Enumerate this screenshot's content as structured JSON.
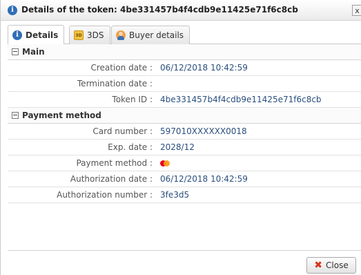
{
  "dialog": {
    "title": "Details of the token: 4be331457b4f4cdb9e11425e71f6c8cb",
    "close_glyph": "x"
  },
  "tabs": [
    {
      "label": "Details",
      "icon": "info-icon",
      "active": true
    },
    {
      "label": "3DS",
      "icon": "3ds-icon",
      "active": false
    },
    {
      "label": "Buyer details",
      "icon": "buyer-icon",
      "active": false
    }
  ],
  "sections": {
    "main": {
      "title": "Main",
      "rows": [
        {
          "label": "Creation date :",
          "value": "06/12/2018 10:42:59"
        },
        {
          "label": "Termination date :",
          "value": ""
        },
        {
          "label": "Token ID :",
          "value": "4be331457b4f4cdb9e11425e71f6c8cb"
        }
      ]
    },
    "payment": {
      "title": "Payment method",
      "rows": [
        {
          "label": "Card number :",
          "value": "597010XXXXXX0018"
        },
        {
          "label": "Exp. date :",
          "value": "2028/12"
        },
        {
          "label": "Payment method :",
          "value": "",
          "icon": "mastercard-icon"
        },
        {
          "label": "Authorization date :",
          "value": "06/12/2018 10:42:59"
        },
        {
          "label": "Authorization number :",
          "value": "3fe3d5"
        }
      ]
    }
  },
  "footer": {
    "close_label": "Close"
  },
  "colors": {
    "value_text": "#2a4f7e",
    "accent_blue": "#2f6fb7",
    "close_icon_red": "#d9341f"
  }
}
